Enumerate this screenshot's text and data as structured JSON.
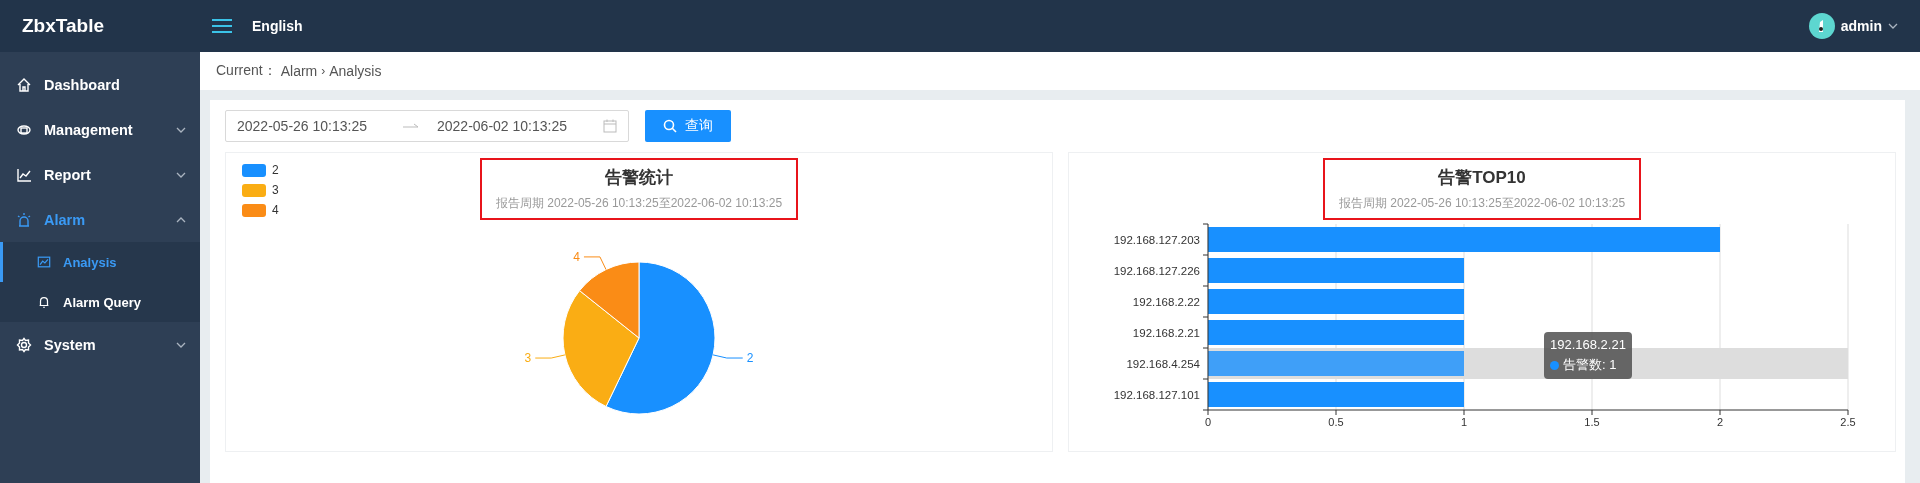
{
  "app": {
    "title": "ZbxTable"
  },
  "header": {
    "language": "English",
    "user": "admin"
  },
  "sidebar": {
    "items": [
      {
        "label": "Dashboard",
        "kind": "item",
        "active": false
      },
      {
        "label": "Management",
        "kind": "group",
        "active": false,
        "expanded": false
      },
      {
        "label": "Report",
        "kind": "group",
        "active": false,
        "expanded": false
      },
      {
        "label": "Alarm",
        "kind": "group",
        "active": true,
        "expanded": true,
        "children": [
          {
            "label": "Analysis",
            "selected": true
          },
          {
            "label": "Alarm Query",
            "selected": false
          }
        ]
      },
      {
        "label": "System",
        "kind": "group",
        "active": false,
        "expanded": false
      }
    ]
  },
  "breadcrumb": {
    "label": "Current：",
    "items": [
      "Alarm",
      "Analysis"
    ],
    "separator": "›"
  },
  "filter": {
    "start": "2022-05-26 10:13:25",
    "end": "2022-06-02 10:13:25",
    "button": "查询"
  },
  "charts": [
    {
      "title": "告警统计",
      "subtitle": "报告周期 2022-05-26 10:13:25至2022-06-02 10:13:25",
      "highlighted": true,
      "legend": [
        {
          "label": "2",
          "color": "#1890ff"
        },
        {
          "label": "3",
          "color": "#faad14"
        },
        {
          "label": "4",
          "color": "#fa8c16"
        }
      ],
      "chart_data": {
        "type": "pie",
        "categories": [
          "2",
          "3",
          "4"
        ],
        "values": [
          57.14,
          28.57,
          14.29
        ]
      }
    },
    {
      "title": "告警TOP10",
      "subtitle": "报告周期 2022-05-26 10:13:25至2022-06-02 10:13:25",
      "highlighted": true,
      "chart_data": {
        "type": "bar",
        "orientation": "horizontal",
        "categories": [
          "192.168.127.203",
          "192.168.127.226",
          "192.168.2.22",
          "192.168.2.21",
          "192.168.4.254",
          "192.168.127.101"
        ],
        "series": [
          {
            "color": "#1890ff",
            "values": [
              2,
              1,
              1,
              1,
              1,
              1
            ]
          }
        ],
        "xlim": [
          0,
          2.5
        ],
        "xticks": [
          0,
          0.5,
          1,
          1.5,
          2,
          2.5
        ],
        "grid": true
      },
      "bars": [
        {
          "hovered": false
        },
        {
          "hovered": false
        },
        {
          "hovered": false
        },
        {
          "hovered": false
        },
        {
          "hovered": true
        },
        {
          "hovered": false
        }
      ],
      "tooltip": {
        "title": "192.168.2.21",
        "label": "告警数: 1",
        "color": "#1890ff"
      }
    }
  ]
}
